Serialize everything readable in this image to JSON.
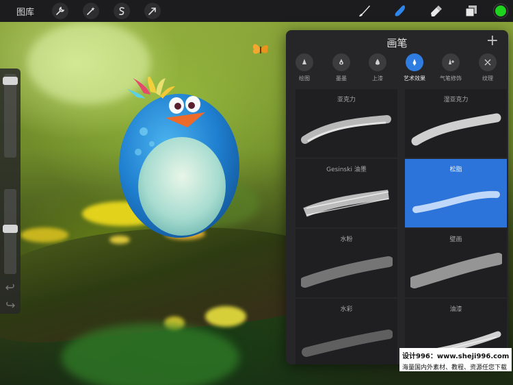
{
  "topbar": {
    "gallery_label": "图库",
    "tools": [
      {
        "name": "wrench-icon"
      },
      {
        "name": "magic-wand-icon"
      },
      {
        "name": "selection-icon"
      },
      {
        "name": "transform-arrow-icon"
      }
    ],
    "right_tools": [
      {
        "name": "brush-icon",
        "active": false
      },
      {
        "name": "smudge-icon",
        "active": true
      },
      {
        "name": "eraser-icon",
        "active": false
      },
      {
        "name": "layers-icon",
        "active": false
      }
    ],
    "current_color": "#1ed21e"
  },
  "colors": {
    "accent": "#2d74da",
    "panel_bg": "#262628",
    "toolbar_bg": "#1c1c1e"
  },
  "brush_panel": {
    "title": "画笔",
    "add_label": "+",
    "categories": [
      {
        "label": "绘图",
        "icon": "pencil-nib-icon"
      },
      {
        "label": "墨墨",
        "icon": "ink-drop-icon"
      },
      {
        "label": "上漆",
        "icon": "paint-drop-icon"
      },
      {
        "label": "艺术效果",
        "icon": "art-nib-icon",
        "active": true
      },
      {
        "label": "气笔修饰",
        "icon": "airbrush-icon"
      },
      {
        "label": "纹理",
        "icon": "texture-icon"
      }
    ],
    "brushes": [
      {
        "name": "亚克力"
      },
      {
        "name": "湿亚克力"
      },
      {
        "name": "Gesinski 油墨"
      },
      {
        "name": "松脂",
        "selected": true
      },
      {
        "name": "水粉"
      },
      {
        "name": "壁画"
      },
      {
        "name": "水彩"
      },
      {
        "name": "油漆"
      }
    ]
  },
  "watermark": {
    "line1": "设计996：www.sheji996.com",
    "line2": "海量国内外素材、教程、资源任您下载"
  }
}
